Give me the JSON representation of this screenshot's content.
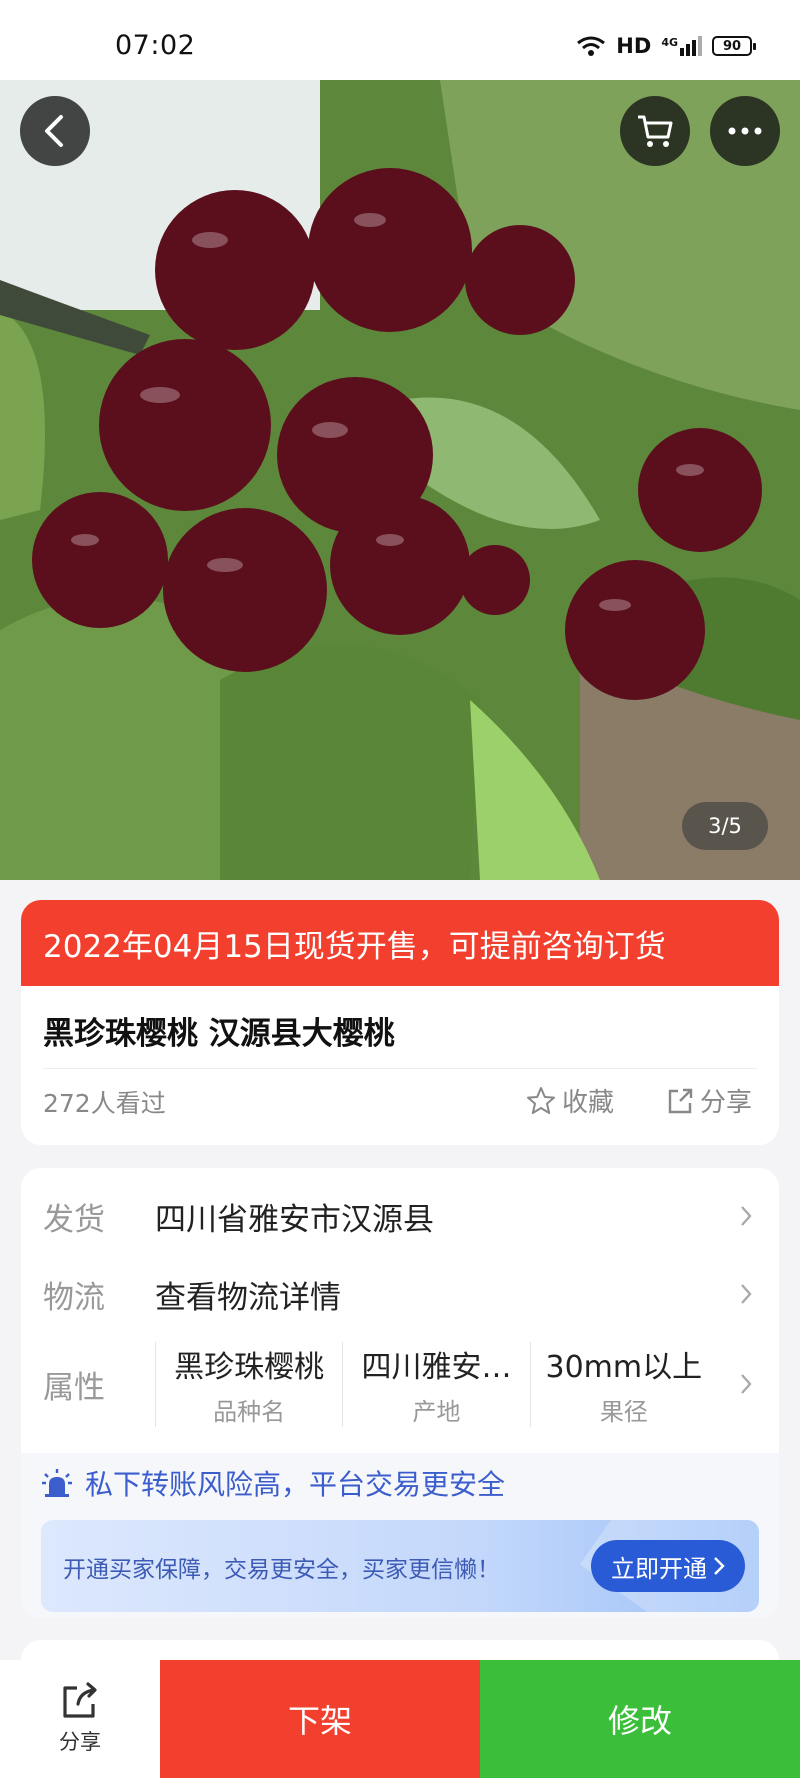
{
  "status_bar": {
    "time": "07:02",
    "network_label": "HD",
    "network_type": "4G",
    "battery": "90"
  },
  "gallery": {
    "counter": "3/5"
  },
  "header_icons": [
    "back-arrow-icon",
    "cart-icon",
    "more-icon"
  ],
  "product": {
    "presale_banner": "2022年04月15日现货开售，可提前咨询订货",
    "title": "黑珍珠樱桃 汉源县大樱桃",
    "views": "272人看过",
    "favorite_label": "收藏",
    "share_label": "分享"
  },
  "details": {
    "shipping": {
      "label": "发货",
      "value": "四川省雅安市汉源县"
    },
    "logistics": {
      "label": "物流",
      "value": "查看物流详情"
    },
    "attributes": {
      "label": "属性",
      "items": [
        {
          "value": "黑珍珠樱桃",
          "name": "品种名"
        },
        {
          "value": "四川雅安…",
          "name": "产地"
        },
        {
          "value": "30mm以上",
          "name": "果径"
        }
      ]
    }
  },
  "safety": {
    "notice": "私下转账风险高，平台交易更安全",
    "promo_text": "开通买家保障，交易更安全，买家更信懒！",
    "promo_button": "立即开通"
  },
  "bottom_bar": {
    "share_label": "分享",
    "delist_label": "下架",
    "edit_label": "修改"
  },
  "colors": {
    "presale_red": "#f3402e",
    "delist_red": "#f33f2d",
    "edit_green": "#3bbf3a",
    "accent_blue": "#2a5bd6"
  }
}
